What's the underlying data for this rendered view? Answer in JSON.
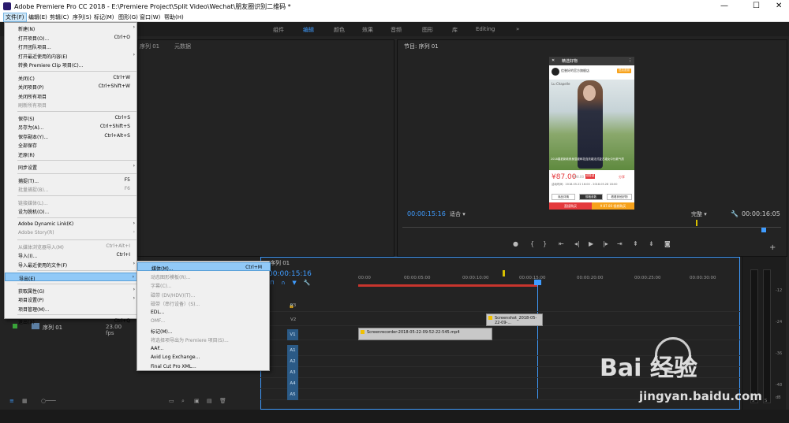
{
  "titlebar": {
    "title": "Adobe Premiere Pro CC 2018 - E:\\Premiere Project\\Split Video\\Wechat\\朋友圈识别二维码 *",
    "minimize": "—",
    "maximize": "☐",
    "close": "✕"
  },
  "menubar": [
    "文件(F)",
    "编辑(E)",
    "剪辑(C)",
    "序列(S)",
    "标记(M)",
    "图形(G)",
    "窗口(W)",
    "帮助(H)"
  ],
  "workspaces": [
    "组件",
    "编辑",
    "颜色",
    "效果",
    "音频",
    "图形",
    "库",
    "Editing",
    "»"
  ],
  "source_panel": {
    "tab_seq": "序列 01",
    "tab_meta": "元数据"
  },
  "program_panel": {
    "tab": "节目: 序列 01",
    "timecode": "00:00:15:16",
    "fit": "适合",
    "quality": "完整",
    "end_timecode": "00:00:16:05"
  },
  "video_frame": {
    "header_title": "精选好物",
    "shop_name": "信誉好的官方旗舰店",
    "shop_button": "进店逛逛",
    "model_name": "Lu Chapelle",
    "caption": "2018春夏新款修身显瘦碎花连衣裙法式复古裙女中长款气质",
    "price": "¥87.00",
    "old_price": "¥98.00",
    "tag": "领券减",
    "share": "分享",
    "line1": "活动时间：2018.05.22 16:00 - 2018.05.28 18:00",
    "tabs": [
      "商品详情",
      "规格参数",
      "看看其他好物"
    ],
    "buy": "直接购买",
    "buy2": "¥ 87.00 领券购买"
  },
  "timeline": {
    "tab": "序列 01",
    "timecode": "00:00:15:16",
    "ruler": [
      "00:00",
      "00:00:05:00",
      "00:00:10:00",
      "00:00:15:00",
      "00:00:20:00",
      "00:00:25:00",
      "00:00:30:00"
    ],
    "tracks_video": [
      "V3",
      "V2",
      "V1"
    ],
    "tracks_audio": [
      "A1",
      "A2",
      "A3",
      "A4",
      "A5"
    ],
    "clip1": "Screenrecorder-2018-05-22-09-52-22-545.mp4",
    "clip2": "Screenshot_2018-05-22-09-..."
  },
  "project": {
    "seq_name": "序列 01",
    "fps": "23.00 fps"
  },
  "file_menu": [
    {
      "label": "新建(N)",
      "shortcut": "",
      "arrow": true,
      "disabled": false
    },
    {
      "label": "打开项目(O)...",
      "shortcut": "Ctrl+O",
      "arrow": false,
      "disabled": false
    },
    {
      "label": "打开团队项目...",
      "shortcut": "",
      "arrow": false,
      "disabled": false
    },
    {
      "label": "打开最近使用的内容(E)",
      "shortcut": "",
      "arrow": true,
      "disabled": false
    },
    {
      "label": "转换 Premiere Clip 项目(C)...",
      "shortcut": "",
      "arrow": false,
      "disabled": false
    },
    {
      "label": "关闭(C)",
      "shortcut": "Ctrl+W",
      "arrow": false,
      "disabled": false
    },
    {
      "label": "关闭项目(P)",
      "shortcut": "Ctrl+Shift+W",
      "arrow": false,
      "disabled": false
    },
    {
      "label": "关闭所有项目",
      "shortcut": "",
      "arrow": false,
      "disabled": false
    },
    {
      "label": "刷新所有项目",
      "shortcut": "",
      "arrow": false,
      "disabled": true
    },
    {
      "label": "保存(S)",
      "shortcut": "Ctrl+S",
      "arrow": false,
      "disabled": false
    },
    {
      "label": "另存为(A)...",
      "shortcut": "Ctrl+Shift+S",
      "arrow": false,
      "disabled": false
    },
    {
      "label": "保存副本(Y)...",
      "shortcut": "Ctrl+Alt+S",
      "arrow": false,
      "disabled": false
    },
    {
      "label": "全部保存",
      "shortcut": "",
      "arrow": false,
      "disabled": false
    },
    {
      "label": "还原(R)",
      "shortcut": "",
      "arrow": false,
      "disabled": false
    },
    {
      "label": "同步设置",
      "shortcut": "",
      "arrow": true,
      "disabled": false
    },
    {
      "label": "捕捉(T)...",
      "shortcut": "F5",
      "arrow": false,
      "disabled": false
    },
    {
      "label": "批量捕捉(B)...",
      "shortcut": "F6",
      "arrow": false,
      "disabled": true
    },
    {
      "label": "链接媒体(L)...",
      "shortcut": "",
      "arrow": false,
      "disabled": true
    },
    {
      "label": "设为脱机(O)...",
      "shortcut": "",
      "arrow": false,
      "disabled": false
    },
    {
      "label": "Adobe Dynamic Link(K)",
      "shortcut": "",
      "arrow": true,
      "disabled": false
    },
    {
      "label": "Adobe Story(R)",
      "shortcut": "",
      "arrow": true,
      "disabled": true
    },
    {
      "label": "从媒体浏览器导入(M)",
      "shortcut": "Ctrl+Alt+I",
      "arrow": false,
      "disabled": true
    },
    {
      "label": "导入(I)...",
      "shortcut": "Ctrl+I",
      "arrow": false,
      "disabled": false
    },
    {
      "label": "导入最近使用的文件(F)",
      "shortcut": "",
      "arrow": true,
      "disabled": false
    },
    {
      "label": "导出(E)",
      "shortcut": "",
      "arrow": true,
      "disabled": false,
      "highlight": true
    },
    {
      "label": "获取属性(G)",
      "shortcut": "",
      "arrow": true,
      "disabled": false
    },
    {
      "label": "项目设置(P)",
      "shortcut": "",
      "arrow": true,
      "disabled": false
    },
    {
      "label": "项目管理(M)...",
      "shortcut": "",
      "arrow": false,
      "disabled": false
    },
    {
      "label": "退出(X)",
      "shortcut": "Ctrl+Q",
      "arrow": false,
      "disabled": false
    }
  ],
  "export_menu": [
    {
      "label": "媒体(M)...",
      "shortcut": "Ctrl+M",
      "disabled": false,
      "highlight": true
    },
    {
      "label": "动态图形模板(R)...",
      "shortcut": "",
      "disabled": true
    },
    {
      "label": "字幕(C)...",
      "shortcut": "",
      "disabled": true
    },
    {
      "label": "磁带 (DV/HDV)(T)...",
      "shortcut": "",
      "disabled": true
    },
    {
      "label": "磁带（串行设备）(S)...",
      "shortcut": "",
      "disabled": true
    },
    {
      "label": "EDL...",
      "shortcut": "",
      "disabled": false
    },
    {
      "label": "OMF...",
      "shortcut": "",
      "disabled": true
    },
    {
      "label": "标记(M)...",
      "shortcut": "",
      "disabled": false
    },
    {
      "label": "将选择项导出为 Premiere 项目(S)...",
      "shortcut": "",
      "disabled": true
    },
    {
      "label": "AAF...",
      "shortcut": "",
      "disabled": false
    },
    {
      "label": "Avid Log Exchange...",
      "shortcut": "",
      "disabled": false
    },
    {
      "label": "Final Cut Pro XML...",
      "shortcut": "",
      "disabled": false
    }
  ],
  "watermark": {
    "brand": "Bai 经验",
    "url": "jingyan.baidu.com"
  },
  "vu": {
    "labels": [
      "-12",
      "-24",
      "-36",
      "-48",
      "dB"
    ],
    "solo": "S"
  }
}
